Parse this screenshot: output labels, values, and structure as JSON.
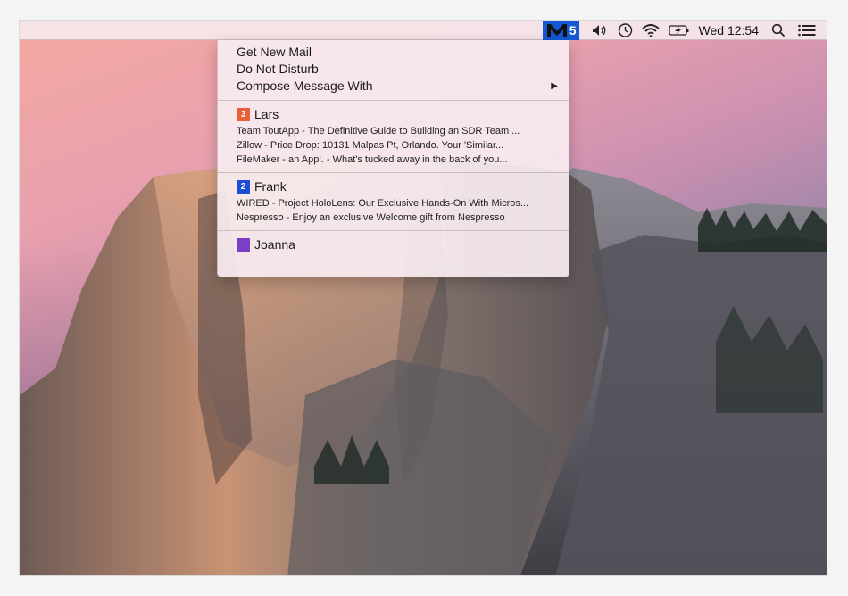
{
  "menubar": {
    "app_count": "5",
    "clock": "Wed 12:54",
    "icons": [
      "app-logo-icon",
      "volume-icon",
      "time-machine-icon",
      "wifi-icon",
      "battery-icon",
      "spotlight-search-icon",
      "notification-center-icon"
    ],
    "app_badge_color": "#1458d6"
  },
  "menu": {
    "actions": {
      "get_new_mail": "Get New Mail",
      "do_not_disturb": "Do Not Disturb",
      "compose_with": "Compose Message With",
      "compose_arrow": "▶"
    },
    "accounts": [
      {
        "name": "Lars",
        "badge": "3",
        "color": "#e8603a",
        "messages": [
          "Team ToutApp - The Definitive Guide to Building an SDR Team ...",
          "Zillow - Price Drop: 10131 Malpas Pt, Orlando. Your 'Similar...",
          "FileMaker - an Appl. - What's tucked away in the back of you..."
        ]
      },
      {
        "name": "Frank",
        "badge": "2",
        "color": "#1d4fd6",
        "messages": [
          "WIRED - Project HoloLens: Our Exclusive Hands-On With Micros...",
          "Nespresso - Enjoy an exclusive Welcome gift from Nespresso"
        ]
      },
      {
        "name": "Joanna",
        "badge": "",
        "color": "#7a3fc4",
        "messages": []
      }
    ]
  }
}
